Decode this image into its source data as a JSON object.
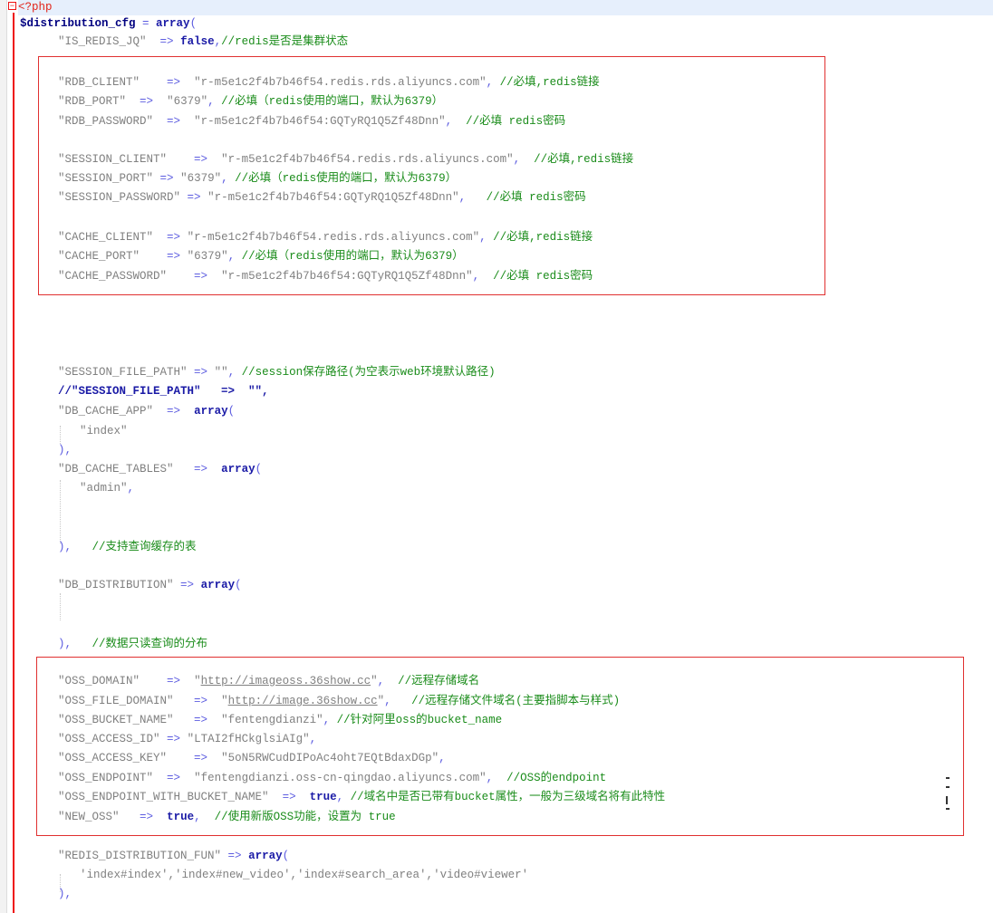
{
  "lines": {
    "l1": {
      "php_open": "<?php"
    },
    "l2": {
      "var": "$distribution_cfg",
      "eq": " = ",
      "kw": "array",
      "paren": "("
    },
    "l3": {
      "key": "\"IS_REDIS_JQ\"",
      "arrow": "=>",
      "val": "false",
      "comma": ",",
      "cmt": "//redis是否是集群状态"
    },
    "l4": {
      "key": "\"RDB_CLIENT\"",
      "arrow": "=>",
      "val": "\"r-m5e1c2f4b7b46f54.redis.rds.aliyuncs.com\"",
      "comma": ",",
      "cmt": "//必填,redis链接"
    },
    "l5": {
      "key": "\"RDB_PORT\"",
      "arrow": "=>",
      "val": "\"6379\"",
      "comma": ",",
      "cmt": "//必填（redis使用的端口，默认为6379）"
    },
    "l6": {
      "key": "\"RDB_PASSWORD\"",
      "arrow": "=>",
      "val": "\"r-m5e1c2f4b7b46f54:GQTyRQ1Q5Zf48Dnn\"",
      "comma": ",",
      "cmt": "//必填 redis密码"
    },
    "l7": {
      "key": "\"SESSION_CLIENT\"",
      "arrow": "=>",
      "val": "\"r-m5e1c2f4b7b46f54.redis.rds.aliyuncs.com\"",
      "comma": ",",
      "cmt": "//必填,redis链接"
    },
    "l8": {
      "key": "\"SESSION_PORT\"",
      "arrow": "=>",
      "val": "\"6379\"",
      "comma": ",",
      "cmt": "//必填（redis使用的端口，默认为6379）"
    },
    "l9": {
      "key": "\"SESSION_PASSWORD\"",
      "arrow": "=>",
      "val": "\"r-m5e1c2f4b7b46f54:GQTyRQ1Q5Zf48Dnn\"",
      "comma": ",",
      "cmt": "//必填 redis密码"
    },
    "l10": {
      "key": "\"CACHE_CLIENT\"",
      "arrow": "=>",
      "val": "\"r-m5e1c2f4b7b46f54.redis.rds.aliyuncs.com\"",
      "comma": ",",
      "cmt": "//必填,redis链接"
    },
    "l11": {
      "key": "\"CACHE_PORT\"",
      "arrow": "=>",
      "val": "\"6379\"",
      "comma": ",",
      "cmt": "//必填（redis使用的端口，默认为6379）"
    },
    "l12": {
      "key": "\"CACHE_PASSWORD\"",
      "arrow": "=>",
      "val": "\"r-m5e1c2f4b7b46f54:GQTyRQ1Q5Zf48Dnn\"",
      "comma": ",",
      "cmt": "//必填 redis密码"
    },
    "l13": {
      "key": "\"SESSION_FILE_PATH\"",
      "arrow": "=>",
      "val": "\"\"",
      "comma": ",",
      "cmt": "//session保存路径(为空表示web环境默认路径)"
    },
    "l14": {
      "cmt": "//\"SESSION_FILE_PATH\"   =>  \"\","
    },
    "l15": {
      "key": "\"DB_CACHE_APP\"",
      "arrow": "=>",
      "kw": "array",
      "paren": "("
    },
    "l16": {
      "val": "\"index\""
    },
    "l17": {
      "close": "),"
    },
    "l18": {
      "key": "\"DB_CACHE_TABLES\"",
      "arrow": "=>",
      "kw": "array",
      "paren": "("
    },
    "l19": {
      "val": "\"admin\"",
      "comma": ","
    },
    "l20": {
      "close": "),",
      "cmt": "//支持查询缓存的表"
    },
    "l21": {
      "key": "\"DB_DISTRIBUTION\"",
      "arrow": "=>",
      "kw": "array",
      "paren": "("
    },
    "l22": {
      "close": "),",
      "cmt": "//数据只读查询的分布"
    },
    "l23": {
      "key": "\"OSS_DOMAIN\"",
      "arrow": "=>",
      "q1": "\"",
      "link": "http://imageoss.36show.cc",
      "q2": "\"",
      "comma": ",",
      "cmt": "//远程存储域名"
    },
    "l24": {
      "key": "\"OSS_FILE_DOMAIN\"",
      "arrow": "=>",
      "q1": "\"",
      "link": "http://image.36show.cc",
      "q2": "\"",
      "comma": ",",
      "cmt": "//远程存储文件域名(主要指脚本与样式)"
    },
    "l25": {
      "key": "\"OSS_BUCKET_NAME\"",
      "arrow": "=>",
      "val": "\"fentengdianzi\"",
      "comma": ",",
      "cmt": "//针对阿里oss的bucket_name"
    },
    "l26": {
      "key": "\"OSS_ACCESS_ID\"",
      "arrow": "=>",
      "val": "\"LTAI2fHCkglsiAIg\"",
      "comma": ","
    },
    "l27": {
      "key": "\"OSS_ACCESS_KEY\"",
      "arrow": "=>",
      "val": "\"5oN5RWCudDIPoAc4oht7EQtBdaxDGp\"",
      "comma": ","
    },
    "l28": {
      "key": "\"OSS_ENDPOINT\"",
      "arrow": "=>",
      "val": "\"fentengdianzi.oss-cn-qingdao.aliyuncs.com\"",
      "comma": ",",
      "cmt": "//OSS的endpoint"
    },
    "l29": {
      "key": "\"OSS_ENDPOINT_WITH_BUCKET_NAME\"",
      "arrow": "=>",
      "val": "true",
      "comma": ",",
      "cmt": "//域名中是否已带有bucket属性，一般为三级域名将有此特性"
    },
    "l30": {
      "key": "\"NEW_OSS\"",
      "arrow": "=>",
      "val": "true",
      "comma": ",",
      "cmt": "//使用新版OSS功能，设置为 true"
    },
    "l31": {
      "key": "\"REDIS_DISTRIBUTION_FUN\"",
      "arrow": "=>",
      "kw": "array",
      "paren": "("
    },
    "l32": {
      "val": "'index#index','index#new_video','index#search_area','video#viewer'"
    },
    "l33": {
      "close": "),"
    }
  },
  "colors": {
    "keyword": "#1a1aa6",
    "string": "#808080",
    "operator": "#5c5ce0",
    "comment": "#1a8c1a",
    "php_tag": "#e1251b",
    "annotation_box": "#e03030",
    "line_highlight": "#e6effc"
  },
  "icons": {
    "fold": "fold-minus-icon"
  }
}
